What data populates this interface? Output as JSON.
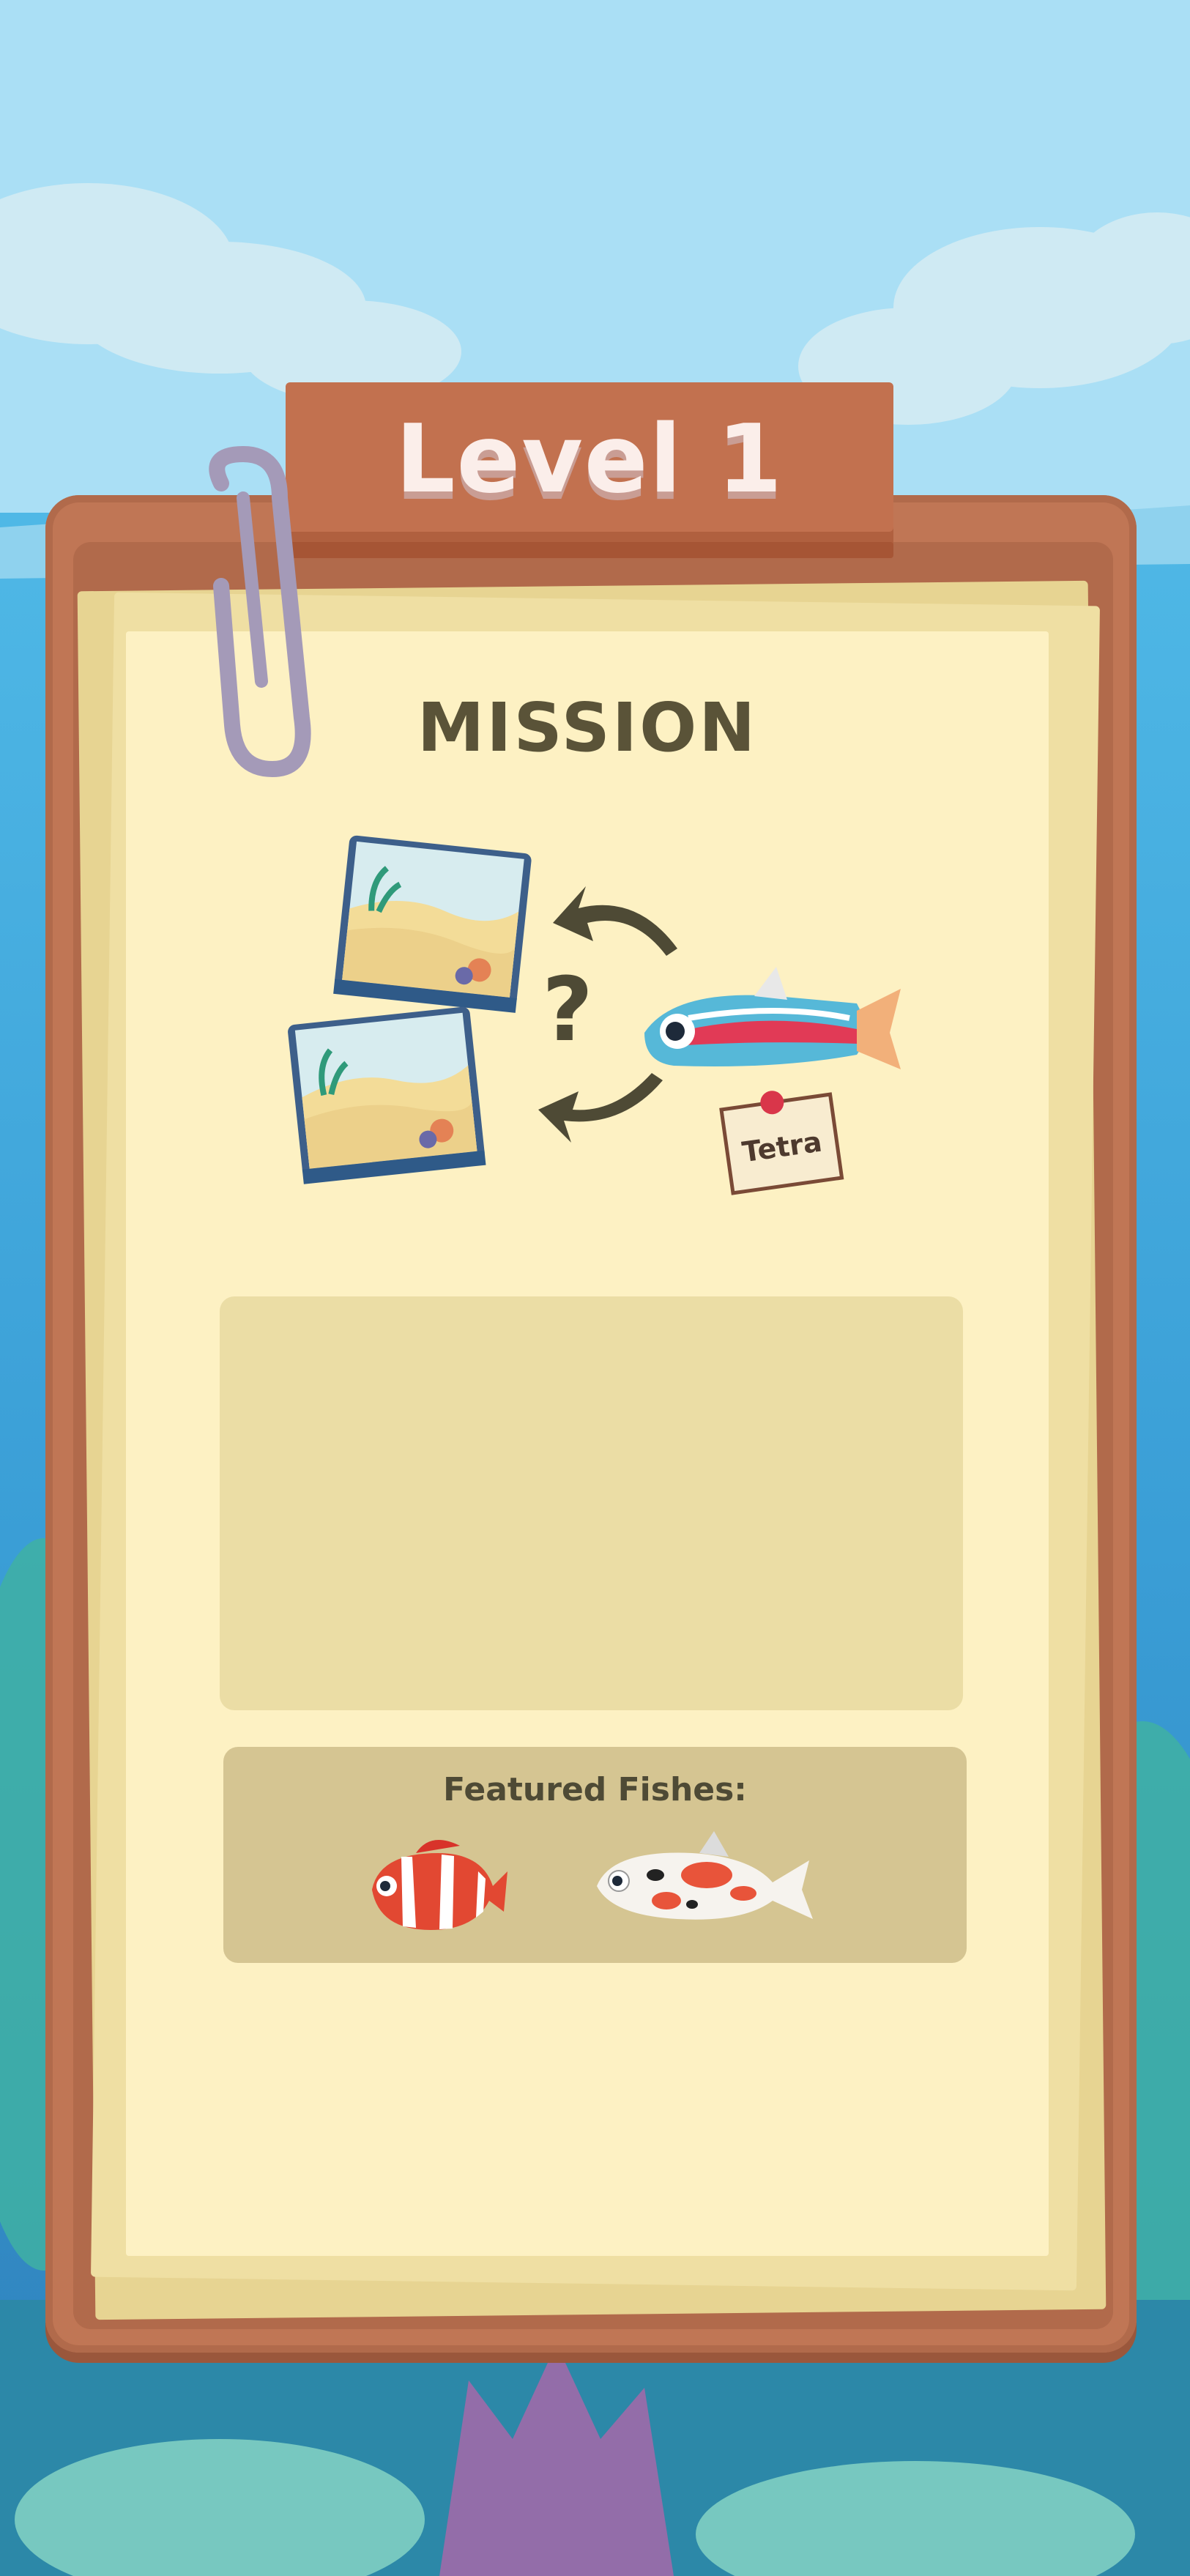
{
  "level": {
    "title": "Level 1"
  },
  "mission": {
    "heading": "MISSION",
    "fish_tag": "Tetra",
    "question_mark": "?"
  },
  "featured": {
    "label": "Featured Fishes:",
    "fishes": [
      "clownfish",
      "koi"
    ]
  },
  "colors": {
    "sky": "#a9def5",
    "wood": "#c07655",
    "paper": "#fdf1c3",
    "text_dark": "#5a5338"
  }
}
